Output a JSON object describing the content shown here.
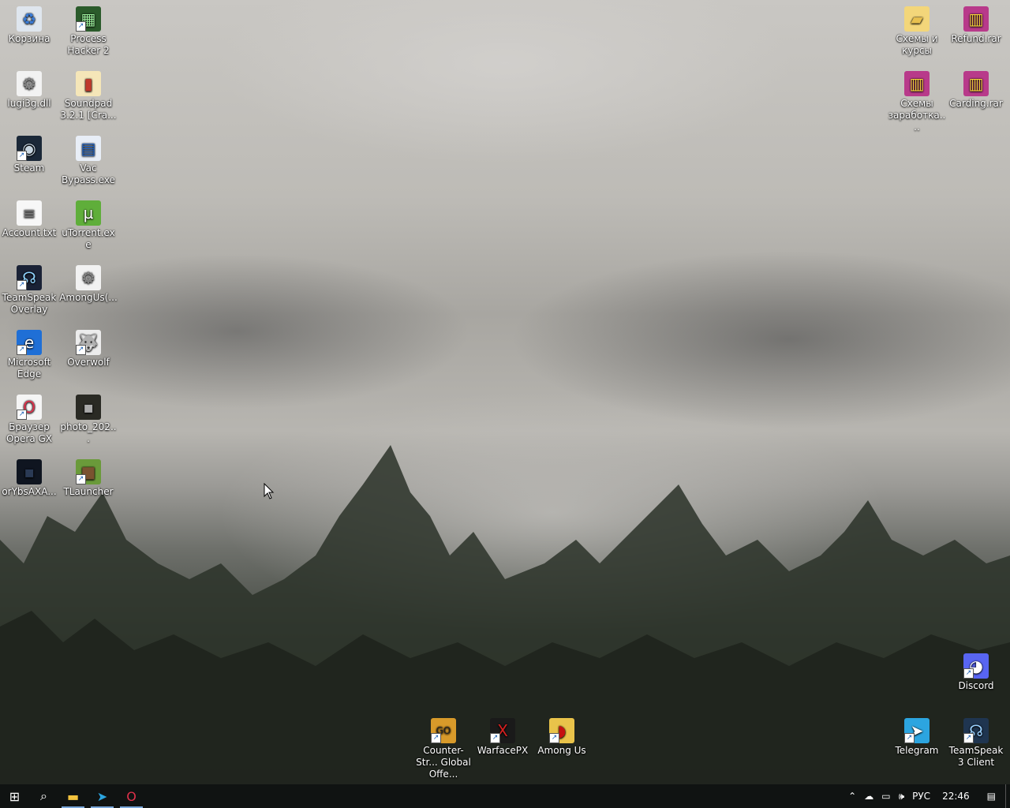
{
  "desktop": {
    "left_icons": [
      {
        "name": "recycle-bin",
        "label": "Корзина",
        "glyph": "♻",
        "bg": "#dfe6ee",
        "fg": "#3a7bd5",
        "shortcut": false
      },
      {
        "name": "process-hacker",
        "label": "Process Hacker 2",
        "glyph": "▦",
        "bg": "#2b5b2b",
        "fg": "#9cf09c",
        "shortcut": true
      },
      {
        "name": "lugi3g-dll",
        "label": "lugi3g.dll",
        "glyph": "⚙",
        "bg": "#f2f2f2",
        "fg": "#888",
        "shortcut": false
      },
      {
        "name": "soundpad",
        "label": "Soundpad 3.2.1 [Cra...",
        "glyph": "▮",
        "bg": "#f5e6b8",
        "fg": "#c0392b",
        "shortcut": false
      },
      {
        "name": "steam",
        "label": "Steam",
        "glyph": "◉",
        "bg": "#1b2838",
        "fg": "#c7d5e0",
        "shortcut": true
      },
      {
        "name": "vac-bypass",
        "label": "Vac Bypass.exe",
        "glyph": "▤",
        "bg": "#e8eef7",
        "fg": "#1e60c0",
        "shortcut": false
      },
      {
        "name": "account-txt",
        "label": "Account.txt",
        "glyph": "≡",
        "bg": "#f7f7f7",
        "fg": "#777",
        "shortcut": false
      },
      {
        "name": "utorrent",
        "label": "uTorrent.exe",
        "glyph": "µ",
        "bg": "#5fae3a",
        "fg": "#fff",
        "shortcut": false
      },
      {
        "name": "teamspeak-overlay",
        "label": "TeamSpeak Overlay",
        "glyph": "☊",
        "bg": "#1a2236",
        "fg": "#8fd3ff",
        "shortcut": true
      },
      {
        "name": "amongus-file",
        "label": "AmongUs(...",
        "glyph": "⚙",
        "bg": "#f2f2f2",
        "fg": "#888",
        "shortcut": false
      },
      {
        "name": "microsoft-edge",
        "label": "Microsoft Edge",
        "glyph": "e",
        "bg": "#1f6fd6",
        "fg": "#fff",
        "shortcut": true
      },
      {
        "name": "overwolf",
        "label": "Overwolf",
        "glyph": "🐺",
        "bg": "#ececec",
        "fg": "#222",
        "shortcut": true
      },
      {
        "name": "opera-gx",
        "label": "Браузер Opera GX",
        "glyph": "O",
        "bg": "#f5f5f5",
        "fg": "#e0314b",
        "shortcut": true
      },
      {
        "name": "photo",
        "label": "photo_202...",
        "glyph": "▪",
        "bg": "#2a2a24",
        "fg": "#aaa",
        "shortcut": false
      },
      {
        "name": "orybsaxa",
        "label": "orYbsAXA...",
        "glyph": "▪",
        "bg": "#0f1520",
        "fg": "#2a3a55",
        "shortcut": false
      },
      {
        "name": "tlauncher",
        "label": "TLauncher",
        "glyph": "■",
        "bg": "#6a9a3a",
        "fg": "#7a5230",
        "shortcut": true
      }
    ],
    "right_icons": [
      {
        "name": "schemes-courses",
        "label": "Схемы и курсы",
        "glyph": "▰",
        "bg": "#f3d67a",
        "fg": "#e8c04f",
        "shortcut": false
      },
      {
        "name": "refund-rar",
        "label": "Refund.rar",
        "glyph": "▥",
        "bg": "#b83a8a",
        "fg": "#f6d33c",
        "shortcut": false
      },
      {
        "name": "schemes-earnings",
        "label": "Схемы заработка....",
        "glyph": "▥",
        "bg": "#b83a8a",
        "fg": "#f6d33c",
        "shortcut": false
      },
      {
        "name": "carding-rar",
        "label": "Carding.rar",
        "glyph": "▥",
        "bg": "#b83a8a",
        "fg": "#f6d33c",
        "shortcut": false
      },
      {
        "name": "discord",
        "label": "Discord",
        "glyph": "◕",
        "bg": "#5865f2",
        "fg": "#fff",
        "shortcut": true
      },
      {
        "name": "telegram",
        "label": "Telegram",
        "glyph": "➤",
        "bg": "#2ca5e0",
        "fg": "#fff",
        "shortcut": true
      },
      {
        "name": "teamspeak3",
        "label": "TeamSpeak 3 Client",
        "glyph": "☊",
        "bg": "#1f3550",
        "fg": "#9ad0ff",
        "shortcut": true
      }
    ],
    "bottom_icons": [
      {
        "name": "csgo",
        "label": "Counter-Str... Global Offe...",
        "glyph": "GO",
        "bg": "#d89a2a",
        "fg": "#222",
        "shortcut": true
      },
      {
        "name": "warfacepx",
        "label": "WarfacePX",
        "glyph": "X",
        "bg": "#1a1a1a",
        "fg": "#d62020",
        "shortcut": true
      },
      {
        "name": "among-us",
        "label": "Among Us",
        "glyph": "◗",
        "bg": "#e9c34a",
        "fg": "#c51111",
        "shortcut": true
      }
    ]
  },
  "taskbar": {
    "start_glyph": "⊞",
    "search_glyph": "⌕",
    "pinned": [
      {
        "name": "file-explorer",
        "glyph": "▬",
        "color": "#f3c23d",
        "active": true
      },
      {
        "name": "telegram",
        "glyph": "➤",
        "color": "#2ca5e0",
        "active": true
      },
      {
        "name": "opera-gx",
        "glyph": "O",
        "color": "#e0314b",
        "active": true
      }
    ],
    "tray": {
      "chevron": "⌃",
      "cloud": "☁",
      "network": "▭",
      "volume": "🕪",
      "language": "РУС",
      "time": "22:46",
      "notifications": "▤"
    }
  }
}
